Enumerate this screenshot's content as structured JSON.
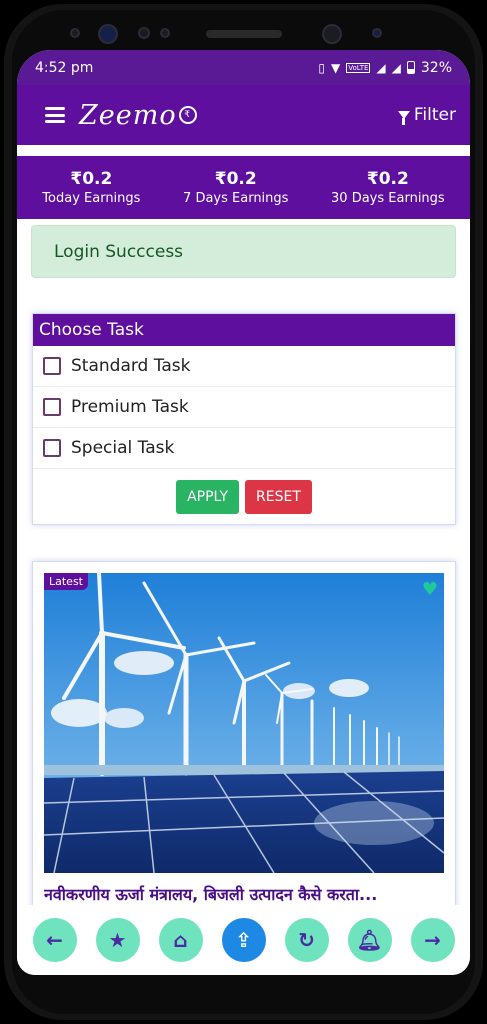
{
  "status_bar": {
    "time": "4:52 pm",
    "battery": "32%",
    "network": "VoLTE",
    "signal_icons": [
      "vibrate-icon",
      "wifi-icon",
      "volte-icon",
      "signal-icon",
      "battery-icon"
    ]
  },
  "app_bar": {
    "brand": "Zeemo",
    "filter_label": "Filter"
  },
  "earnings": [
    {
      "value": "₹0.2",
      "label": "Today Earnings"
    },
    {
      "value": "₹0.2",
      "label": "7 Days Earnings"
    },
    {
      "value": "₹0.2",
      "label": "30 Days Earnings"
    }
  ],
  "alert": {
    "message": "Login Succcess"
  },
  "task_filter": {
    "title": "Choose Task",
    "options": [
      "Standard Task",
      "Premium Task",
      "Special Task"
    ],
    "apply_label": "APPLY",
    "reset_label": "RESET"
  },
  "news": {
    "badge": "Latest",
    "title": "नवीकरणीय ऊर्जा मंत्रालय, बिजली उत्पादन कैसे करता..."
  },
  "bottom_nav": [
    "arrow-left-icon",
    "star-icon",
    "home-icon",
    "share-icon",
    "refresh-icon",
    "bell-icon",
    "arrow-right-icon"
  ],
  "colors": {
    "primary": "#5e0f9e",
    "accent": "#6fe3bd",
    "success_bg": "#d4edda",
    "apply": "#28b463",
    "reset": "#dc3545"
  }
}
